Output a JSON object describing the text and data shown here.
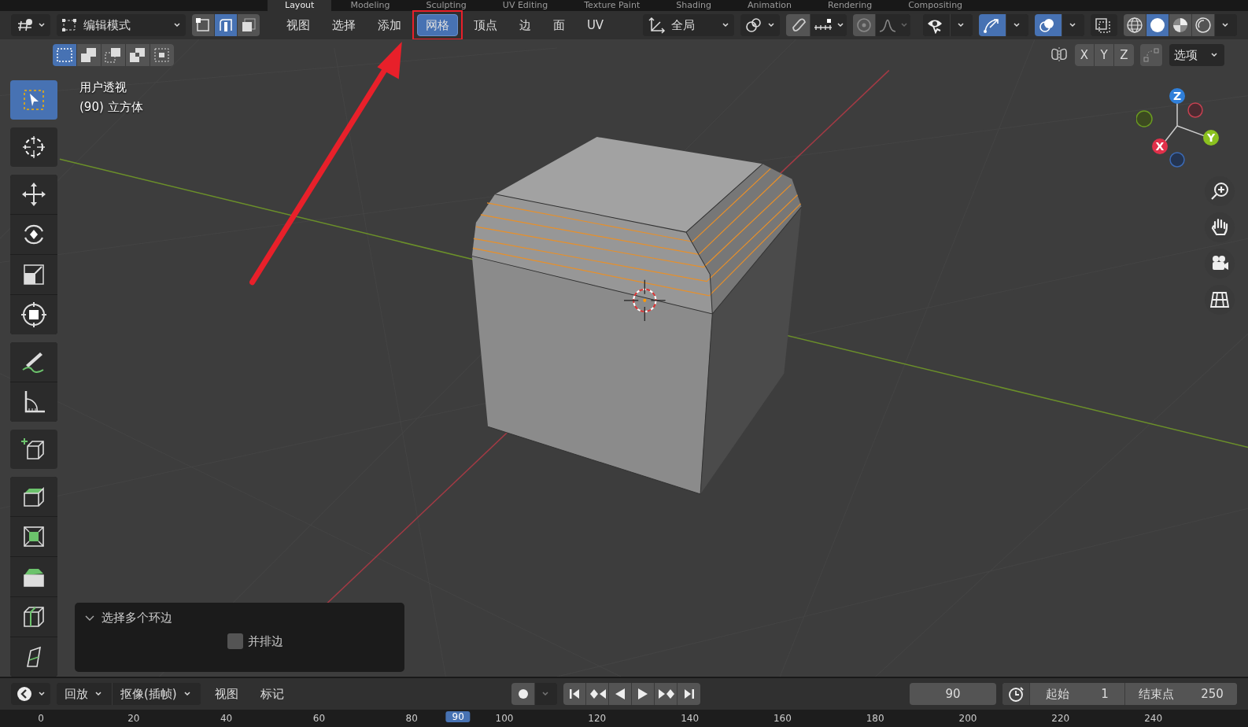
{
  "workspace_tabs": [
    {
      "label": "Layout",
      "selected": true
    },
    {
      "label": "Modeling",
      "selected": false
    },
    {
      "label": "Sculpting",
      "selected": false
    },
    {
      "label": "UV Editing",
      "selected": false
    },
    {
      "label": "Texture Paint",
      "selected": false
    },
    {
      "label": "Shading",
      "selected": false
    },
    {
      "label": "Animation",
      "selected": false
    },
    {
      "label": "Rendering",
      "selected": false
    },
    {
      "label": "Compositing",
      "selected": false
    }
  ],
  "header": {
    "mode": "编辑模式",
    "select_modes": [
      {
        "kind": "vertex",
        "selected": false
      },
      {
        "kind": "edge",
        "selected": true
      },
      {
        "kind": "face",
        "selected": false
      }
    ],
    "menus": [
      {
        "label": "视图",
        "selected": false,
        "annotated": false
      },
      {
        "label": "选择",
        "selected": false,
        "annotated": false
      },
      {
        "label": "添加",
        "selected": false,
        "annotated": false
      },
      {
        "label": "网格",
        "selected": true,
        "annotated": true
      },
      {
        "label": "顶点",
        "selected": false,
        "annotated": false
      },
      {
        "label": "边",
        "selected": false,
        "annotated": false
      },
      {
        "label": "面",
        "selected": false,
        "annotated": false
      },
      {
        "label": "UV",
        "selected": false,
        "annotated": false
      }
    ],
    "orientation": "全局",
    "snap": {
      "on": false
    },
    "proportional": {
      "on": false
    },
    "toggles": [
      {
        "kind": "visibility",
        "on": false
      },
      {
        "kind": "gizmo",
        "on": true
      },
      {
        "kind": "overlay",
        "on": true
      },
      {
        "kind": "xray",
        "on": false
      }
    ],
    "shading": [
      {
        "kind": "wireframe",
        "selected": false
      },
      {
        "kind": "solid",
        "selected": true
      },
      {
        "kind": "material",
        "selected": false
      },
      {
        "kind": "rendered",
        "selected": false
      }
    ]
  },
  "subheader": {
    "box_modes": [
      {
        "kind": "new",
        "selected": true
      },
      {
        "kind": "extend",
        "selected": false
      },
      {
        "kind": "subtract",
        "selected": false
      },
      {
        "kind": "invert",
        "selected": false
      },
      {
        "kind": "intersect",
        "selected": false
      }
    ],
    "mirror_axes": [
      {
        "label": "X",
        "on": false
      },
      {
        "label": "Y",
        "on": false
      },
      {
        "label": "Z",
        "on": false
      }
    ],
    "options": "选项"
  },
  "viewport": {
    "view_name": "用户透视",
    "object_info": "(90) 立方体",
    "gizmo_labels": [
      "X",
      "Y",
      "Z"
    ]
  },
  "tools": [
    [
      {
        "kind": "select",
        "selected": true
      }
    ],
    [
      {
        "kind": "cursor",
        "selected": false
      }
    ],
    [
      {
        "kind": "move",
        "selected": false
      },
      {
        "kind": "rotate",
        "selected": false
      },
      {
        "kind": "scale",
        "selected": false
      },
      {
        "kind": "transform",
        "selected": false
      }
    ],
    [
      {
        "kind": "annotate",
        "selected": false
      },
      {
        "kind": "measure",
        "selected": false
      }
    ],
    [
      {
        "kind": "add_cube",
        "selected": false
      }
    ],
    [
      {
        "kind": "extrude",
        "selected": false
      },
      {
        "kind": "inset",
        "selected": false
      },
      {
        "kind": "bevel",
        "selected": false
      },
      {
        "kind": "loop_cut",
        "selected": false
      },
      {
        "kind": "knife",
        "selected": false
      }
    ]
  ],
  "operator_panel": {
    "title": "选择多个环边",
    "expanded": true,
    "option": {
      "label": "并排边",
      "checked": false
    }
  },
  "timeline": {
    "playback": "回放",
    "keying": "抠像(插帧)",
    "menus": [
      "视图",
      "标记"
    ],
    "auto_key": false,
    "current_frame": "90",
    "start_label": "起始",
    "start": "1",
    "end_label": "结束点",
    "end": "250",
    "ruler": [
      {
        "label": "0",
        "selected": false
      },
      {
        "label": "20",
        "selected": false
      },
      {
        "label": "40",
        "selected": false
      },
      {
        "label": "60",
        "selected": false
      },
      {
        "label": "80",
        "selected": false
      },
      {
        "label": "90",
        "selected": true
      },
      {
        "label": "100",
        "selected": false
      },
      {
        "label": "120",
        "selected": false
      },
      {
        "label": "140",
        "selected": false
      },
      {
        "label": "160",
        "selected": false
      },
      {
        "label": "180",
        "selected": false
      },
      {
        "label": "200",
        "selected": false
      },
      {
        "label": "220",
        "selected": false
      },
      {
        "label": "240",
        "selected": false
      }
    ]
  }
}
